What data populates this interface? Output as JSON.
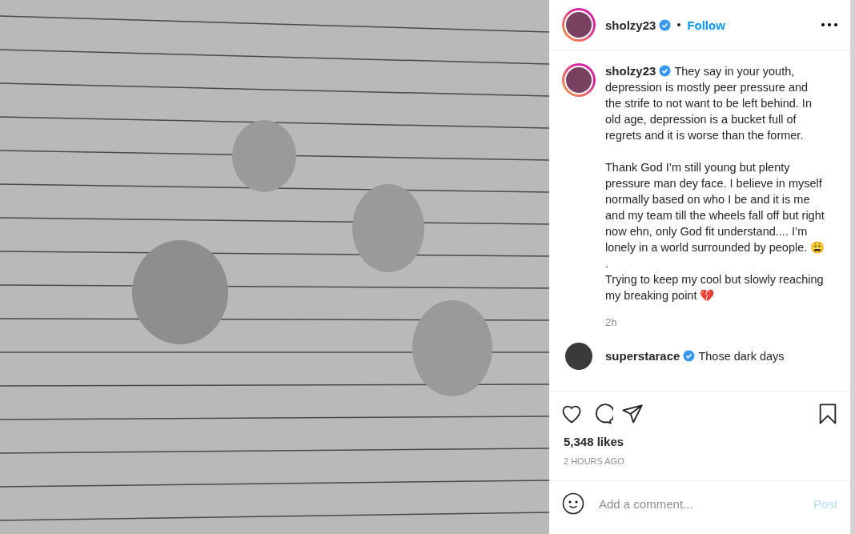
{
  "header": {
    "username": "sholzy23",
    "verified": true,
    "follow": "Follow"
  },
  "caption": {
    "username": "sholzy23",
    "verified": true,
    "text": "They say in your youth, depression is mostly peer pressure and the strife to not want to be left behind. In old age, depression is a bucket full of regrets and it is worse than the former.",
    "paragraphs": [
      "Thank God I’m still young but plenty pressure man dey face. I believe in myself normally based on who I be and it is me and my team till the wheels fall off but right now ehn, only God fit understand.... I’m lonely in a world surrounded by people. 😩",
      ".",
      "Trying to keep my cool but slowly reaching my breaking point 💔"
    ],
    "time": "2h"
  },
  "comments": [
    {
      "username": "superstarace",
      "verified": true,
      "text": "Those dark days"
    }
  ],
  "likes": "5,348 likes",
  "posted": "2 HOURS AGO",
  "comment_field": {
    "placeholder": "Add a comment..."
  },
  "post_button": "Post"
}
